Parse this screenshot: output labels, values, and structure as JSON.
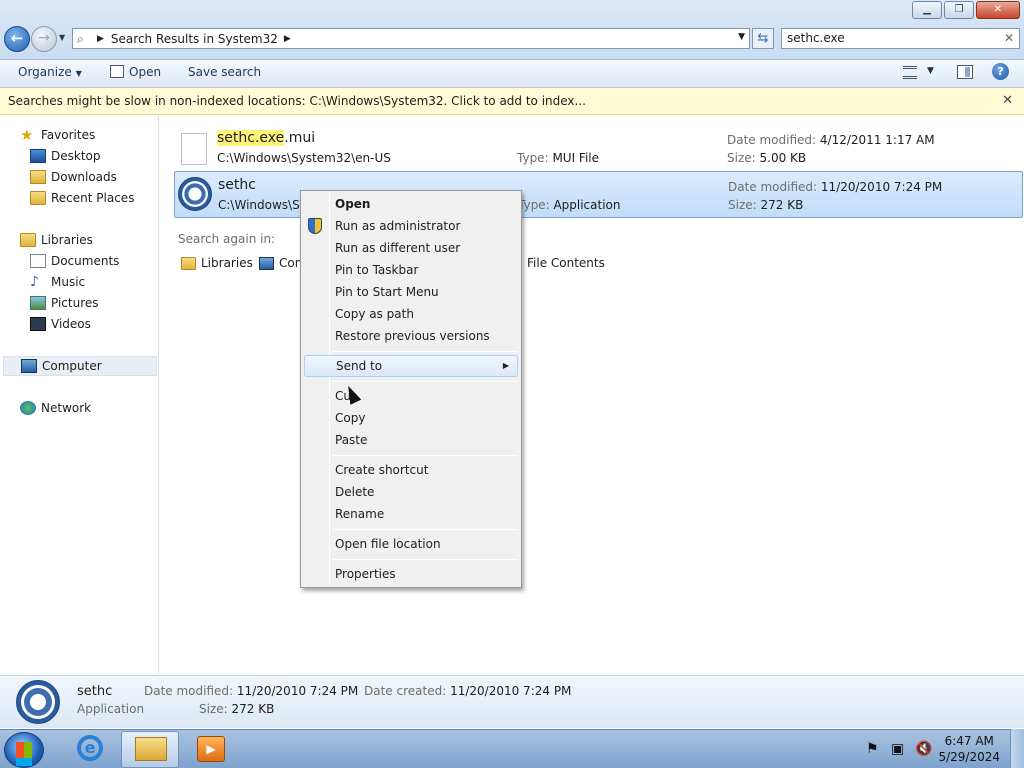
{
  "window": {
    "min_icon": "minimize-icon",
    "max_icon": "maximize-icon",
    "close_icon": "close-icon"
  },
  "address": {
    "crumb": "Search Results in System32"
  },
  "search": {
    "value": "sethc.exe"
  },
  "toolbar": {
    "organize": "Organize",
    "open": "Open",
    "save_search": "Save search"
  },
  "infobar": {
    "message": "Searches might be slow in non-indexed locations: C:\\Windows\\System32. Click to add to index..."
  },
  "nav": {
    "favorites": "Favorites",
    "desktop": "Desktop",
    "downloads": "Downloads",
    "recent": "Recent Places",
    "libraries": "Libraries",
    "documents": "Documents",
    "music": "Music",
    "pictures": "Pictures",
    "videos": "Videos",
    "computer": "Computer",
    "network": "Network"
  },
  "results": [
    {
      "name_highlight": "sethc.exe",
      "name_rest": ".mui",
      "path": "C:\\Windows\\System32\\en-US",
      "type_label": "Type:",
      "type": "MUI File",
      "modified_label": "Date modified:",
      "modified": "4/12/2011 1:17 AM",
      "size_label": "Size:",
      "size": "5.00 KB"
    },
    {
      "name": "sethc",
      "path": "C:\\Windows\\System32",
      "type_label": "Type:",
      "type": "Application",
      "modified_label": "Date modified:",
      "modified": "11/20/2010 7:24 PM",
      "size_label": "Size:",
      "size": "272 KB"
    }
  ],
  "search_again": {
    "label": "Search again in:",
    "libraries": "Libraries",
    "computer": "Computer",
    "file_contents": "File Contents"
  },
  "context_menu": {
    "open": "Open",
    "run_admin": "Run as administrator",
    "run_different": "Run as different user",
    "pin_taskbar": "Pin to Taskbar",
    "pin_start": "Pin to Start Menu",
    "copy_path": "Copy as path",
    "restore": "Restore previous versions",
    "send_to": "Send to",
    "cut": "Cut",
    "copy": "Copy",
    "paste": "Paste",
    "create_shortcut": "Create shortcut",
    "delete": "Delete",
    "rename": "Rename",
    "open_location": "Open file location",
    "properties": "Properties"
  },
  "details": {
    "name": "sethc",
    "type": "Application",
    "modified_label": "Date modified:",
    "modified": "11/20/2010 7:24 PM",
    "created_label": "Date created:",
    "created": "11/20/2010 7:24 PM",
    "size_label": "Size:",
    "size": "272 KB"
  },
  "taskbar": {
    "time": "6:47 AM",
    "date": "5/29/2024"
  }
}
